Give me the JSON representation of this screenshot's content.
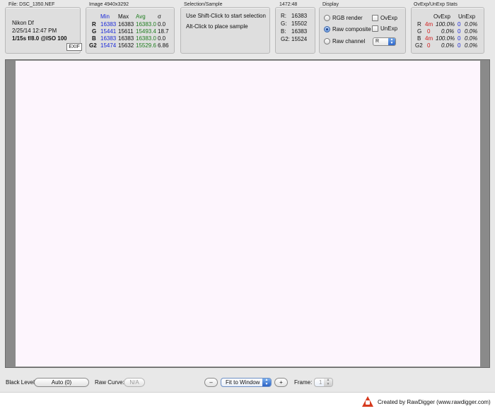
{
  "file_panel": {
    "title": "File: DSC_1350.NEF",
    "camera": "Nikon Df",
    "datetime": "2/25/14 12:47 PM",
    "exposure": "1/15s f/8.0 @ISO 100",
    "exif_label": "EXIF"
  },
  "image_panel": {
    "title": "Image 4940x3292",
    "headers": {
      "min": "Min",
      "max": "Max",
      "avg": "Avg",
      "sigma": "σ"
    },
    "rows": [
      {
        "channel": "R",
        "min": "16383",
        "max": "16383",
        "avg": "16383.0",
        "sigma": "0.0"
      },
      {
        "channel": "G",
        "min": "15441",
        "max": "15611",
        "avg": "15493.4",
        "sigma": "18.7"
      },
      {
        "channel": "B",
        "min": "16383",
        "max": "16383",
        "avg": "16383.0",
        "sigma": "0.0"
      },
      {
        "channel": "G2",
        "min": "15474",
        "max": "15632",
        "avg": "15529.6",
        "sigma": "6.86"
      }
    ]
  },
  "selection_panel": {
    "title": "Selection/Sample",
    "line1": "Use Shift-Click to start selection",
    "line2": "Alt-Click to place sample"
  },
  "coord_panel": {
    "title": "1472:48",
    "rows": [
      {
        "label": "R:",
        "value": "16383"
      },
      {
        "label": "G:",
        "value": "15502"
      },
      {
        "label": "B:",
        "value": "16383"
      },
      {
        "label": "G2:",
        "value": "15524"
      }
    ]
  },
  "display_panel": {
    "title": "Display",
    "rgb_render": "RGB render",
    "raw_composite": "Raw composite",
    "raw_channel": "Raw channel",
    "ovexp": "OvExp",
    "unexp": "UnExp",
    "channel_value": "R",
    "selected_mode": "raw_composite"
  },
  "stats_panel": {
    "title": "OvExp/UnExp Stats",
    "headers": {
      "ovexp": "OvExp",
      "unexp": "UnExp"
    },
    "rows": [
      {
        "channel": "R",
        "ov_count": "4m",
        "ov_pct": "100.0%",
        "un_count": "0",
        "un_pct": "0.0%"
      },
      {
        "channel": "G",
        "ov_count": "0",
        "ov_pct": "0.0%",
        "un_count": "0",
        "un_pct": "0.0%"
      },
      {
        "channel": "B",
        "ov_count": "4m",
        "ov_pct": "100.0%",
        "un_count": "0",
        "un_pct": "0.0%"
      },
      {
        "channel": "G2",
        "ov_count": "0",
        "ov_pct": "0.0%",
        "un_count": "0",
        "un_pct": "0.0%"
      }
    ]
  },
  "bottom_bar": {
    "black_level_label": "Black Level:",
    "black_level_value": "Auto (0)",
    "raw_curve_label": "Raw Curve:",
    "raw_curve_value": "N/A",
    "zoom_out": "–",
    "zoom_value": "Fit to Window",
    "zoom_in": "+",
    "frame_label": "Frame:",
    "frame_value": "1"
  },
  "footer": {
    "credit": "Created by RawDigger (www.rawdigger.com)"
  },
  "colors": {
    "min_blue": "#1a28d8",
    "avg_green": "#1e7d1e",
    "ovexp_red": "#d21818",
    "canvas": "#fdf5fd"
  }
}
